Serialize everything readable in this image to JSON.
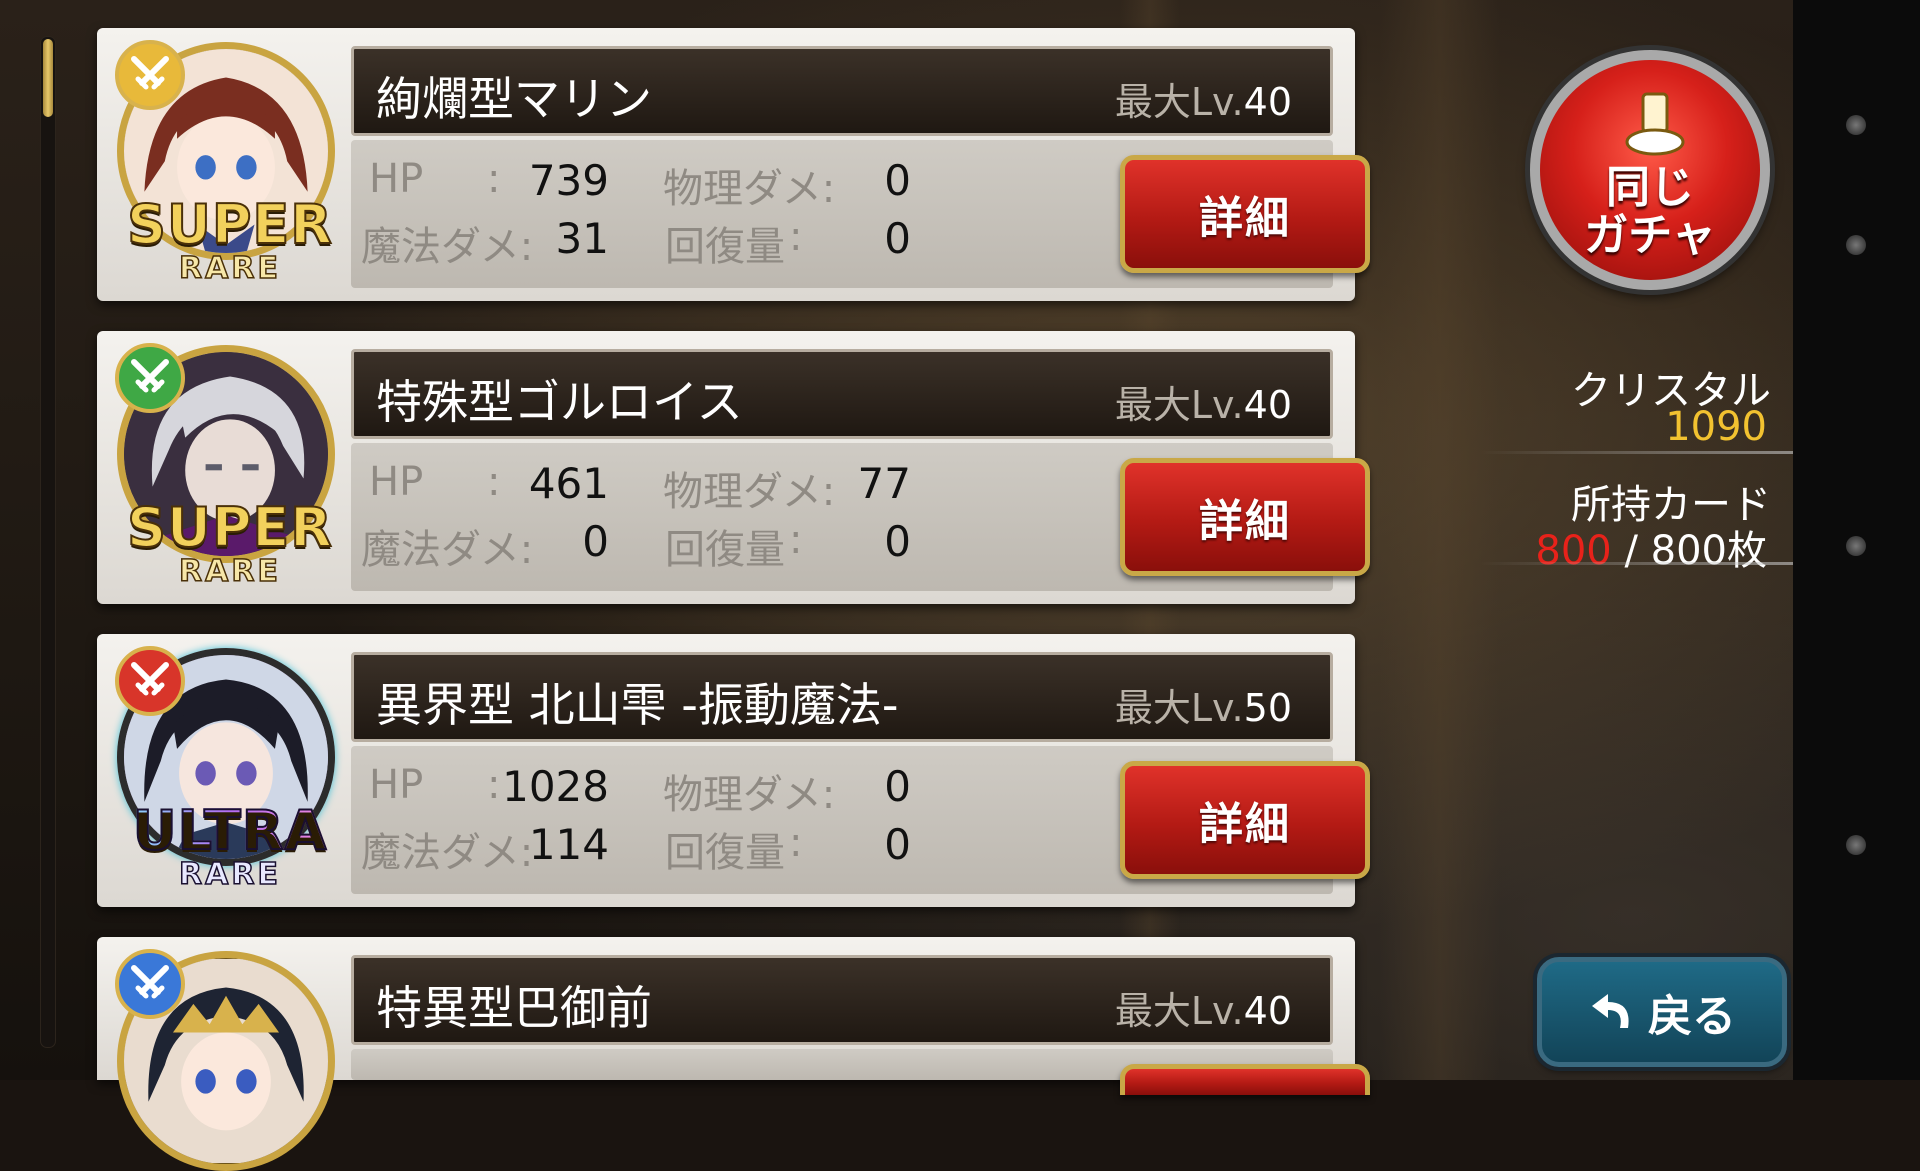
{
  "cards": [
    {
      "name": "絢爛型マリン",
      "lv_prefix": "最大Lv.",
      "max_lv": "40",
      "rarity_main": "SUPER",
      "rarity_sub": "RARE",
      "class_icon": "crossed-swords-icon",
      "class_color": "#e8b93a",
      "portrait_hair": "#6b2a1e",
      "hp_label": "HP",
      "hp_colon": ":",
      "hp": "739",
      "phys_label": "物理ダメ:",
      "phys": "0",
      "magic_label": "魔法ダメ:",
      "magic": "31",
      "heal_label": "回復量",
      "heal_colon": ":",
      "heal": "0",
      "detail_label": "詳細"
    },
    {
      "name": "特殊型ゴルロイス",
      "lv_prefix": "最大Lv.",
      "max_lv": "40",
      "rarity_main": "SUPER",
      "rarity_sub": "RARE",
      "class_icon": "crossed-swords-icon",
      "class_color": "#3fa845",
      "portrait_hair": "#c9c9cf",
      "hp_label": "HP",
      "hp_colon": ":",
      "hp": "461",
      "phys_label": "物理ダメ:",
      "phys": "77",
      "magic_label": "魔法ダメ:",
      "magic": "0",
      "heal_label": "回復量",
      "heal_colon": ":",
      "heal": "0",
      "detail_label": "詳細"
    },
    {
      "name": "異界型 北山雫 -振動魔法-",
      "lv_prefix": "最大Lv.",
      "max_lv": "50",
      "rarity_main": "ULTRA",
      "rarity_sub": "RARE",
      "class_icon": "crossed-swords-icon",
      "class_color": "#d8352a",
      "portrait_hair": "#1d1d2a",
      "hp_label": "HP",
      "hp_colon": ":",
      "hp": "1028",
      "phys_label": "物理ダメ:",
      "phys": "0",
      "magic_label": "魔法ダメ:",
      "magic": "114",
      "heal_label": "回復量",
      "heal_colon": ":",
      "heal": "0",
      "detail_label": "詳細"
    },
    {
      "name": "特異型巴御前",
      "lv_prefix": "最大Lv.",
      "max_lv": "40",
      "class_icon": "crossed-swords-icon",
      "class_color": "#3a78d8",
      "portrait_hair": "#1e2433"
    }
  ],
  "gacha_button": {
    "line1": "同じ",
    "line2": "ガチャ"
  },
  "crystal": {
    "label": "クリスタル",
    "value": "1090",
    "value_color": "#f2c230"
  },
  "owned_cards": {
    "label": "所持カード",
    "current": "800",
    "separator": " / ",
    "max": "800枚",
    "current_color": "#e8221a"
  },
  "back_button": {
    "label": "戻る"
  },
  "scroll": {
    "position_fraction": 0.0
  }
}
